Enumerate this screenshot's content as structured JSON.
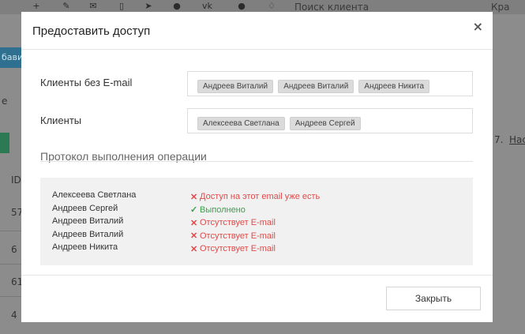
{
  "background": {
    "search_placeholder": "Поиск клиента",
    "right_top_text": "Кра",
    "left_button_text": "бави",
    "left_text_e": "е",
    "left_text_id": "ID",
    "row_nums": [
      "57",
      "6",
      "61",
      "4"
    ],
    "right_text_7": "7.",
    "right_text_nas": "Нас"
  },
  "modal": {
    "title": "Предоставить доступ",
    "close_icon": "×",
    "clients_without_email_label": "Клиенты без E-mail",
    "clients_without_email": [
      "Андреев Виталий",
      "Андреев Виталий",
      "Андреев Никита"
    ],
    "clients_label": "Клиенты",
    "clients": [
      "Алексеева Светлана",
      "Андреев Сергей"
    ],
    "protocol_title": "Протокол выполнения операции",
    "log": [
      {
        "name": "Алексеева Светлана",
        "status": "Доступ на этот email уже есть",
        "type": "error",
        "mark": "✕"
      },
      {
        "name": "Андреев Сергей",
        "status": "Выполнено",
        "type": "ok",
        "mark": "✓"
      },
      {
        "name": "Андреев Виталий",
        "status": "Отсутствует E-mail",
        "type": "error",
        "mark": "✕"
      },
      {
        "name": "Андреев Виталий",
        "status": "Отсутствует E-mail",
        "type": "error",
        "mark": "✕"
      },
      {
        "name": "Андреев Никита",
        "status": "Отсутствует E-mail",
        "type": "error",
        "mark": "✕"
      }
    ],
    "close_button": "Закрыть"
  },
  "colors": {
    "error": "#e04a4a",
    "ok": "#3aa04a",
    "overlay": "#8c8c8c"
  }
}
